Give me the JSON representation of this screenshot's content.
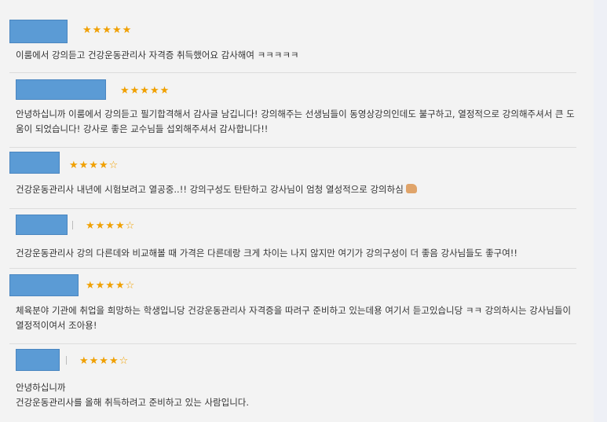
{
  "reviews": [
    {
      "rating": "★★★★★",
      "text": "이룸에서 강의듣고 건강운동관리사 자격증 취득했어요 감사해여 ㅋㅋㅋㅋㅋ"
    },
    {
      "rating": "★★★★★",
      "text": "안녕하십니까 이룸에서 강의듣고 필기합격해서 감사글 남깁니다! 강의해주는 선생님들이 동영상강의인데도 불구하고, 열정적으로 강의해주셔서 큰 도움이 되었습니다! 강사로 좋은 교수님들 섭외해주셔서 감사합니다!!"
    },
    {
      "rating": "★★★★☆",
      "text": "건강운동관리사 내년에 시험보려고 열공중..!! 강의구성도 탄탄하고 강사님이 엄청 열성적으로 강의하심",
      "emoji_icon": "thumbs-up-icon"
    },
    {
      "rating": "★★★★☆",
      "text": "건강운동관리사 강의 다른데와 비교해볼 때 가격은 다른데랑 크게 차이는 나지 않지만 여기가 강의구성이 더 좋음 강사님들도 좋구여!!"
    },
    {
      "rating": "★★★★☆",
      "text": "체육분야 기관에 취업을 희망하는 학생입니당 건강운동관리사 자격증을 따려구 준비하고 있는데용 여기서 듣고있습니당 ㅋㅋ 강의하시는 강사님들이 열정적이여서 조아용!"
    },
    {
      "rating": "★★★★☆",
      "text": "안녕하십니까\n건강운동관리사를 올해 취득하려고 준비하고 있는 사람입니다."
    }
  ],
  "colors": {
    "star": "#f0a000",
    "avatar": "#5b9bd5",
    "background": "#f3f3f3"
  }
}
